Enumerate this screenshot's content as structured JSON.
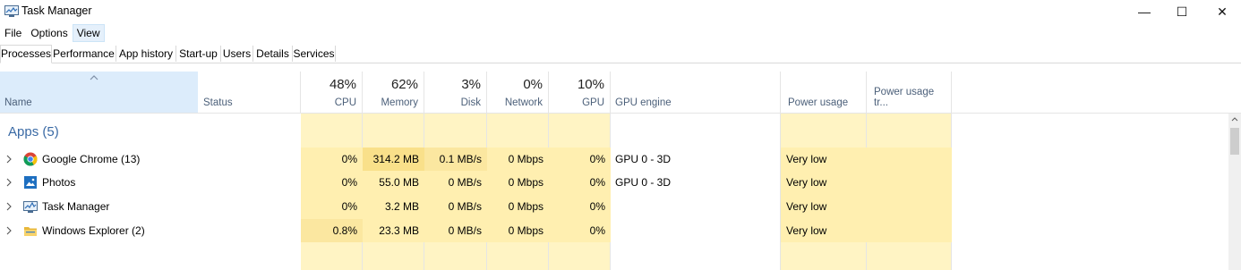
{
  "window": {
    "title": "Task Manager",
    "controls": {
      "minimize": "—",
      "maximize": "☐",
      "close": "✕"
    }
  },
  "menu": [
    {
      "label": "File"
    },
    {
      "label": "Options"
    },
    {
      "label": "View"
    }
  ],
  "tabs": [
    {
      "label": "Processes"
    },
    {
      "label": "Performance"
    },
    {
      "label": "App history"
    },
    {
      "label": "Start-up"
    },
    {
      "label": "Users"
    },
    {
      "label": "Details"
    },
    {
      "label": "Services"
    }
  ],
  "columns": {
    "name": "Name",
    "status": "Status",
    "cpu": {
      "pct": "48%",
      "label": "CPU"
    },
    "memory": {
      "pct": "62%",
      "label": "Memory"
    },
    "disk": {
      "pct": "3%",
      "label": "Disk"
    },
    "network": {
      "pct": "0%",
      "label": "Network"
    },
    "gpu": {
      "pct": "10%",
      "label": "GPU"
    },
    "gpu_engine": "GPU engine",
    "power_usage": "Power usage",
    "power_trend": "Power usage tr..."
  },
  "group": {
    "title": "Apps (5)"
  },
  "rows": [
    {
      "name": "Google Chrome (13)",
      "icon": "chrome-icon",
      "cpu": "0%",
      "memory": "314.2 MB",
      "disk": "0.1 MB/s",
      "network": "0 Mbps",
      "gpu": "0%",
      "gpu_engine": "GPU 0 - 3D",
      "power": "Very low"
    },
    {
      "name": "Photos",
      "icon": "photos-icon",
      "cpu": "0%",
      "memory": "55.0 MB",
      "disk": "0 MB/s",
      "network": "0 Mbps",
      "gpu": "0%",
      "gpu_engine": "GPU 0 - 3D",
      "power": "Very low"
    },
    {
      "name": "Task Manager",
      "icon": "task-manager-icon",
      "cpu": "0%",
      "memory": "3.2 MB",
      "disk": "0 MB/s",
      "network": "0 Mbps",
      "gpu": "0%",
      "gpu_engine": "",
      "power": "Very low"
    },
    {
      "name": "Windows Explorer (2)",
      "icon": "folder-icon",
      "cpu": "0.8%",
      "memory": "23.3 MB",
      "disk": "0 MB/s",
      "network": "0 Mbps",
      "gpu": "0%",
      "gpu_engine": "",
      "power": "Very low"
    }
  ],
  "colors": {
    "heat_light": "#fff4c4",
    "heat_mid": "#ffefb0",
    "heat_strong": "#f9e08a",
    "header_selected": "#dcecfb",
    "group_title": "#3a6aa5"
  }
}
